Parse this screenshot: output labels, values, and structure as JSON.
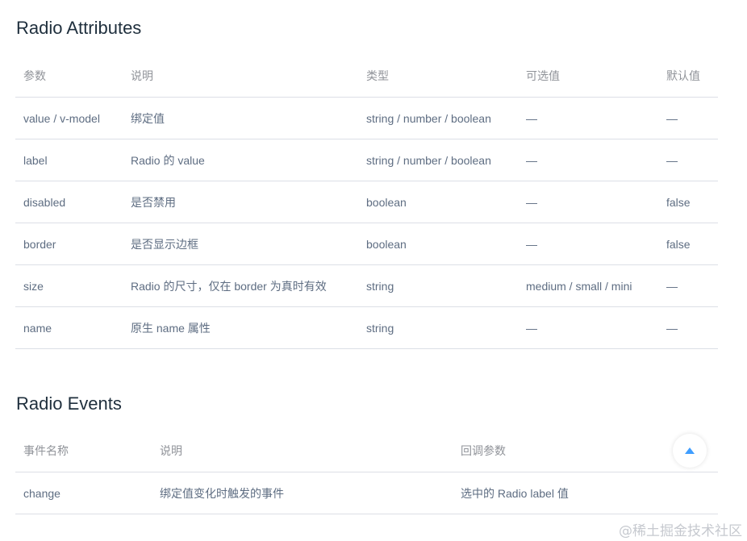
{
  "attributes": {
    "title": "Radio Attributes",
    "headers": [
      "参数",
      "说明",
      "类型",
      "可选值",
      "默认值"
    ],
    "rows": [
      [
        "value / v-model",
        "绑定值",
        "string / number / boolean",
        "—",
        "—"
      ],
      [
        "label",
        "Radio 的 value",
        "string / number / boolean",
        "—",
        "—"
      ],
      [
        "disabled",
        "是否禁用",
        "boolean",
        "—",
        "false"
      ],
      [
        "border",
        "是否显示边框",
        "boolean",
        "—",
        "false"
      ],
      [
        "size",
        "Radio 的尺寸，仅在 border 为真时有效",
        "string",
        "medium / small / mini",
        "—"
      ],
      [
        "name",
        "原生 name 属性",
        "string",
        "—",
        "—"
      ]
    ]
  },
  "events": {
    "title": "Radio Events",
    "headers": [
      "事件名称",
      "说明",
      "回调参数"
    ],
    "rows": [
      [
        "change",
        "绑定值变化时触发的事件",
        "选中的 Radio label 值"
      ]
    ]
  },
  "back_to_top": {
    "icon": "caret-up-icon",
    "color": "#409eff"
  },
  "watermark": "@稀土掘金技术社区"
}
